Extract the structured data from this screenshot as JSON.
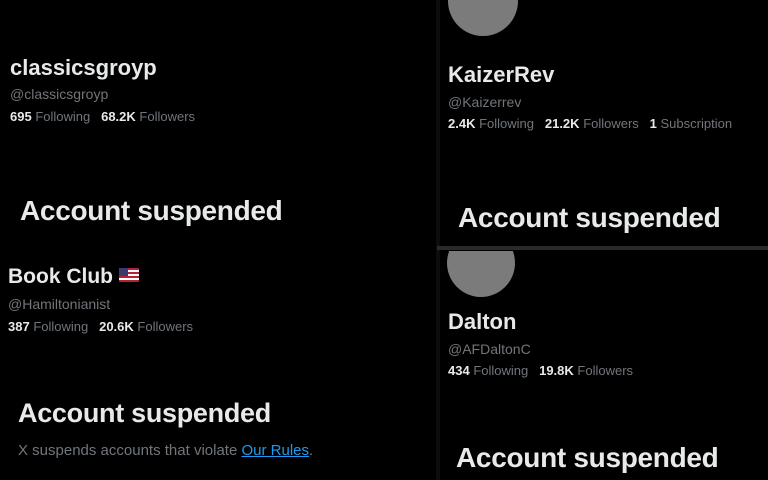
{
  "accounts": [
    {
      "name": "classicsgroyp",
      "handle": "@classicsgroyp",
      "following_count": "695",
      "following_label": "Following",
      "followers_count": "68.2K",
      "followers_label": "Followers",
      "status": "Account suspended"
    },
    {
      "name": "KaizerRev",
      "handle": "@Kaizerrev",
      "following_count": "2.4K",
      "following_label": "Following",
      "followers_count": "21.2K",
      "followers_label": "Followers",
      "subscriptions_count": "1",
      "subscriptions_label": "Subscription",
      "status": "Account suspended"
    },
    {
      "name": "Book Club",
      "flag_icon": "us-flag-icon",
      "handle": "@Hamiltonianist",
      "following_count": "387",
      "following_label": "Following",
      "followers_count": "20.6K",
      "followers_label": "Followers",
      "status": "Account suspended",
      "description_prefix": "X suspends accounts that violate ",
      "rules_link": "Our Rules",
      "description_suffix": "."
    },
    {
      "name": "Dalton",
      "handle": "@AFDaltonC",
      "following_count": "434",
      "following_label": "Following",
      "followers_count": "19.8K",
      "followers_label": "Followers",
      "status": "Account suspended"
    }
  ],
  "colors": {
    "background": "#000000",
    "primary_text": "#e7e9ea",
    "secondary_text": "#71767b",
    "link": "#1d9bf0",
    "avatar": "#7b7b7b"
  }
}
